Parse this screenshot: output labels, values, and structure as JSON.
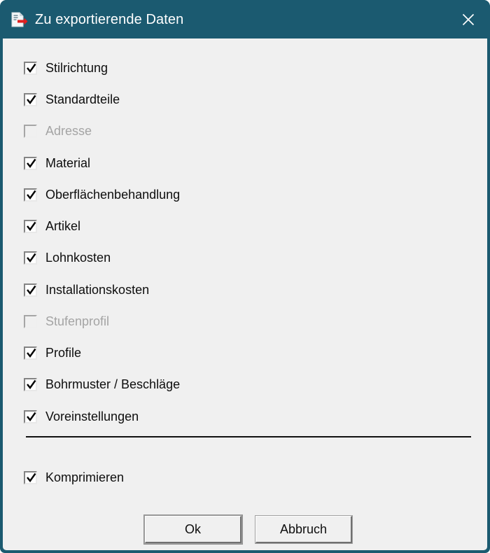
{
  "window": {
    "title": "Zu exportierende Daten",
    "title_icon": "export-document-icon",
    "close_icon": "close-icon",
    "titlebar_color": "#1b5a70",
    "client_color": "#f0f0f0"
  },
  "checkboxes": [
    {
      "label": "Stilrichtung",
      "checked": true,
      "disabled": false
    },
    {
      "label": "Standardteile",
      "checked": true,
      "disabled": false
    },
    {
      "label": "Adresse",
      "checked": false,
      "disabled": true
    },
    {
      "label": "Material",
      "checked": true,
      "disabled": false
    },
    {
      "label": "Oberflächenbehandlung",
      "checked": true,
      "disabled": false
    },
    {
      "label": "Artikel",
      "checked": true,
      "disabled": false
    },
    {
      "label": "Lohnkosten",
      "checked": true,
      "disabled": false
    },
    {
      "label": "Installationskosten",
      "checked": true,
      "disabled": false
    },
    {
      "label": "Stufenprofil",
      "checked": false,
      "disabled": true
    },
    {
      "label": "Profile",
      "checked": true,
      "disabled": false
    },
    {
      "label": "Bohrmuster / Beschläge",
      "checked": true,
      "disabled": false
    },
    {
      "label": "Voreinstellungen",
      "checked": true,
      "disabled": false
    }
  ],
  "compress": {
    "label": "Komprimieren",
    "checked": true,
    "disabled": false
  },
  "buttons": {
    "ok": "Ok",
    "cancel": "Abbruch"
  }
}
